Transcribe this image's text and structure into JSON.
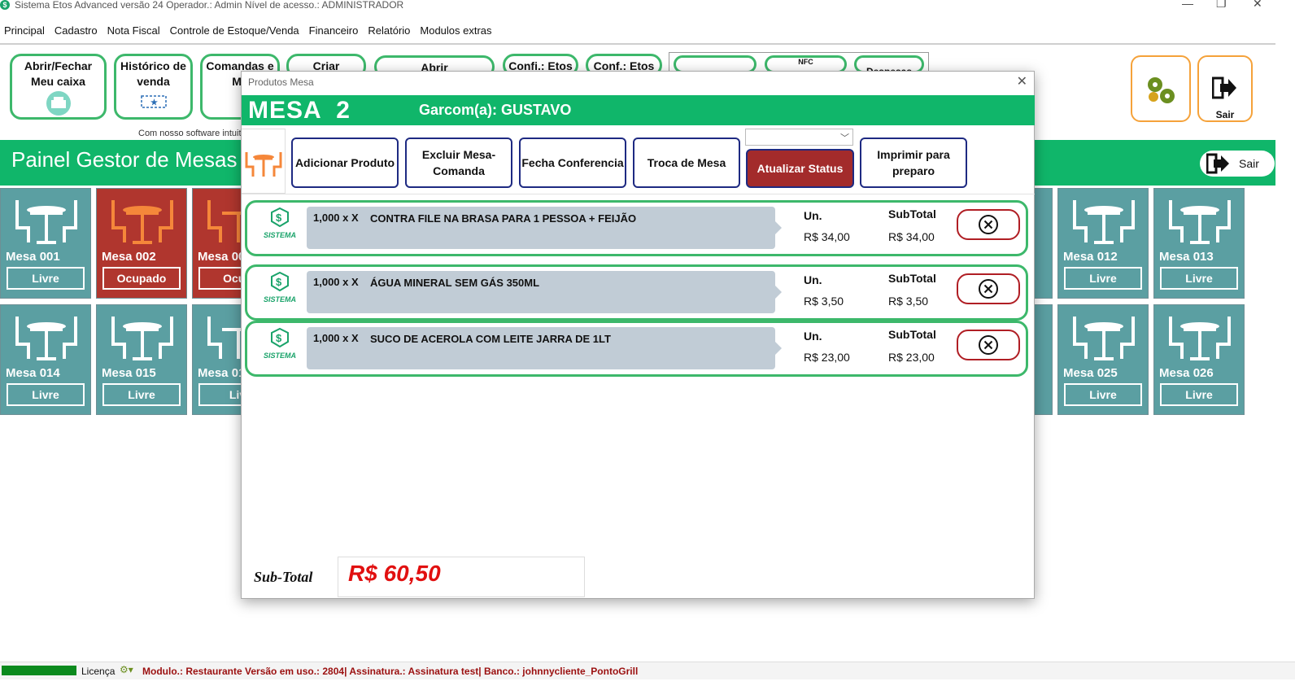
{
  "window": {
    "title": "Sistema Etos  Advanced versão 24  Operador.: Admin Nível de acesso.: ADMINISTRADOR",
    "minimize": "—",
    "maximize": "❐",
    "close": "✕"
  },
  "menu": [
    "Principal",
    "Cadastro",
    "Nota Fiscal",
    "Controle de Estoque/Venda",
    "Financeiro",
    "Relatório",
    "Modulos extras"
  ],
  "toolbar": {
    "caixa": "Abrir/Fechar Meu caixa",
    "historico": "Histórico de venda",
    "comandas": "Comandas e Me",
    "criar": "Criar",
    "abrir": "Abrir",
    "confi_etos": "Confi.: Etos",
    "conf_etos": "Conf.: Etos",
    "despesas": "Despesas",
    "nfce": "NFC",
    "promo": "Com nosso software intuit"
  },
  "right_buttons": {
    "sair": "Sair"
  },
  "panel": {
    "title": "Painel Gestor de Mesas",
    "sair": "Sair"
  },
  "mesas": [
    {
      "name": "Mesa 001",
      "status": "Livre"
    },
    {
      "name": "Mesa 002",
      "status": "Ocupado"
    },
    {
      "name": "Mesa 00",
      "status": "Ocup"
    },
    {
      "name": "Mesa 012",
      "status": "Livre"
    },
    {
      "name": "Mesa 013",
      "status": "Livre"
    },
    {
      "name": "Mesa 014",
      "status": "Livre"
    },
    {
      "name": "Mesa 015",
      "status": "Livre"
    },
    {
      "name": "Mesa 01",
      "status": "Liv"
    },
    {
      "name": "Mesa 025",
      "status": "Livre"
    },
    {
      "name": "Mesa 026",
      "status": "Livre"
    }
  ],
  "modal": {
    "title": "Produtos Mesa",
    "mesa": "MESA  2",
    "garcom": "Garcom(a): GUSTAVO",
    "buttons": {
      "adicionar": "Adicionar Produto",
      "excluir": "Excluir Mesa-Comanda",
      "fecha": "Fecha Conferencia",
      "troca": "Troca de Mesa",
      "atualizar": "Atualizar Status",
      "imprimir": "Imprimir para preparo"
    },
    "dropdown_value": "",
    "logo_text": "SISTEMA",
    "un_header": "Un.",
    "subtotal_header": "SubTotal",
    "items": [
      {
        "qty": "1,000 x X",
        "name": "CONTRA FILE NA BRASA PARA 1 PESSOA + FEIJÃO",
        "un": "R$ 34,00",
        "subtotal": "R$ 34,00"
      },
      {
        "qty": "1,000 x X",
        "name": "ÁGUA MINERAL SEM GÁS 350ML",
        "un": "R$ 3,50",
        "subtotal": "R$ 3,50"
      },
      {
        "qty": "1,000 x X",
        "name": "SUCO DE ACEROLA COM LEITE JARRA DE 1LT",
        "un": "R$ 23,00",
        "subtotal": "R$ 23,00"
      }
    ],
    "subtotal_label": "Sub-Total",
    "subtotal_value": "R$ 60,50"
  },
  "statusbar": {
    "licenca": "Licença",
    "modulo": "Modulo.: Restaurante Versão em uso.: 2804| Assinatura.: Assinatura test| Banco.: johnnycliente_PontoGrill"
  },
  "colors": {
    "green": "#10b66a",
    "teal": "#5b9fa2",
    "occupied": "#b0362e",
    "button_red": "#a32b2b",
    "total_red": "#e11010"
  }
}
